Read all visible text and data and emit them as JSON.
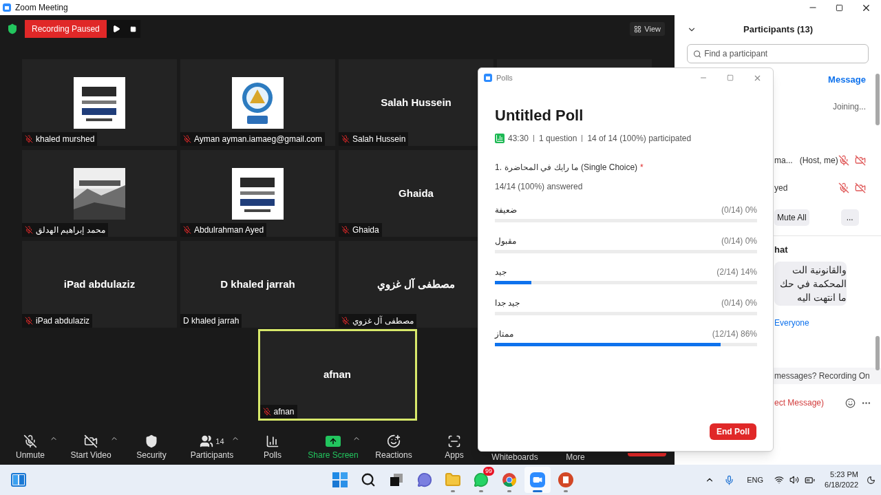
{
  "window": {
    "title": "Zoom Meeting"
  },
  "recording": {
    "label": "Recording Paused",
    "paused": true
  },
  "view_button": "View",
  "tiles": [
    {
      "name": "khaled murshed",
      "kind": "picture",
      "muted": true
    },
    {
      "name": "Ayman ayman.iamaeg@gmail.com",
      "kind": "picture",
      "muted": true
    },
    {
      "name": "Salah Hussein",
      "kind": "name",
      "display": "Salah Hussein",
      "muted": true
    },
    {
      "name": "محمد إبراهيم الهدلق",
      "kind": "picture",
      "muted": true
    },
    {
      "name": "Abdulrahman Ayed",
      "kind": "picture",
      "muted": true
    },
    {
      "name": "Ghaida",
      "kind": "name",
      "display": "Ghaida",
      "muted": true
    },
    {
      "name": "iPad abdulaziz",
      "kind": "name",
      "display": "iPad abdulaziz",
      "muted": true
    },
    {
      "name": "D khaled jarrah",
      "kind": "name",
      "display": "D khaled jarrah",
      "muted": false
    },
    {
      "name": "مصطفى آل غزوي",
      "kind": "name",
      "display": "مصطفى آل غزوي",
      "muted": true
    }
  ],
  "active_tile": {
    "name": "afnan",
    "display": "afnan",
    "muted": true,
    "highlighted": true
  },
  "toolbar": [
    {
      "label": "Unmute",
      "kind": "mic_off",
      "caret": true
    },
    {
      "label": "Start Video",
      "kind": "video_off",
      "caret": true
    },
    {
      "label": "Security",
      "kind": "security",
      "caret": false
    },
    {
      "label": "Participants",
      "kind": "participants",
      "count": "14",
      "caret": true
    },
    {
      "label": "Polls",
      "kind": "polls",
      "caret": false
    },
    {
      "label": "Share Screen",
      "kind": "share",
      "caret": true
    },
    {
      "label": "Reactions",
      "kind": "reactions",
      "caret": false
    },
    {
      "label": "Apps",
      "kind": "apps",
      "caret": false
    },
    {
      "label": "Whiteboards",
      "kind": "plain",
      "caret": false
    },
    {
      "label": "More",
      "kind": "plain",
      "caret": false
    }
  ],
  "participants_panel": {
    "title": "Participants (13)",
    "search_placeholder": "Find a participant",
    "message_link": "Message",
    "joining": "Joining...",
    "rows": [
      {
        "name": "ma...",
        "role": "(Host, me)",
        "muted": true,
        "video_off": true
      },
      {
        "name": "yed",
        "muted": true,
        "video_off": true
      }
    ],
    "mute_all": "Mute All",
    "more": "..."
  },
  "chat": {
    "title": "hat",
    "message_lines": [
      "والقانونية الت",
      "المحكمة في حك",
      "ما انتهت اليه"
    ],
    "recipient": "Everyone",
    "notice": "messages? Recording On",
    "input_hint": "ect Message)"
  },
  "poll": {
    "window_title": "Polls",
    "title": "Untitled Poll",
    "duration": "43:30",
    "question_count": "1 question",
    "participation": "14 of 14 (100%) participated",
    "question": {
      "number": "1.",
      "text": "ما رايك في المحاضرة",
      "type": "(Single Choice)",
      "required": true,
      "required_mark": "*",
      "answered": "14/14 (100%) answered"
    },
    "answers": [
      {
        "label": "ضعيفة",
        "result": "(0/14) 0%",
        "level": 0
      },
      {
        "label": "مقبول",
        "result": "(0/14) 0%",
        "level": 0
      },
      {
        "label": "جيد",
        "result": "(2/14) 14%",
        "level": 0.14
      },
      {
        "label": "جيد جدا",
        "result": "(0/14) 0%",
        "level": 0
      },
      {
        "label": "ممتاز",
        "result": "(12/14) 86%",
        "level": 0.86
      }
    ],
    "end_button": "End Poll"
  },
  "taskbar": {
    "apps": [
      {
        "kind": "start",
        "running": false,
        "selected": false
      },
      {
        "kind": "search",
        "running": false,
        "selected": false
      },
      {
        "kind": "taskview",
        "running": false,
        "selected": false
      },
      {
        "kind": "chat",
        "running": false,
        "selected": false
      },
      {
        "kind": "explorer",
        "running": true,
        "selected": false
      },
      {
        "kind": "whatsapp",
        "running": true,
        "selected": false,
        "badge": "99"
      },
      {
        "kind": "chrome",
        "running": true,
        "selected": false
      },
      {
        "kind": "zoom",
        "running": true,
        "selected": true
      },
      {
        "kind": "powerpoint",
        "running": true,
        "selected": false
      }
    ],
    "language": "ENG",
    "time": "5:23 PM",
    "date": "6/18/2022"
  }
}
